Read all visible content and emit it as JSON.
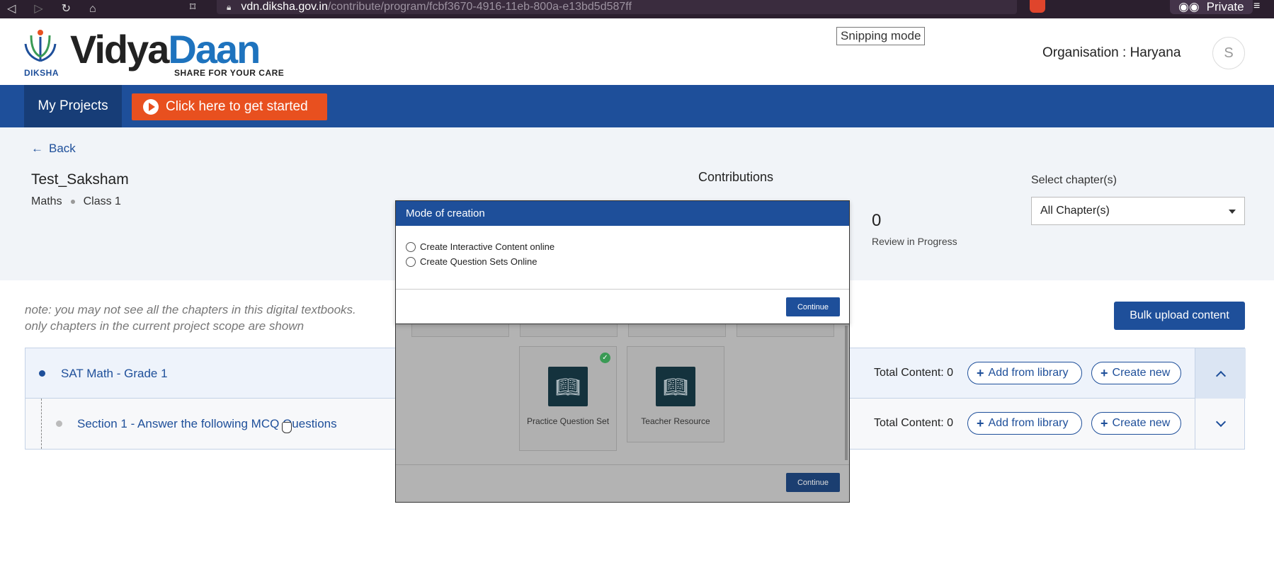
{
  "browser": {
    "url_host": "vdn.diksha.gov.in",
    "url_path": "/contribute/program/fcbf3670-4916-11eb-800a-e13bd5d587ff",
    "private_label": "Private"
  },
  "header": {
    "logo_diksha": "DIKSHA",
    "logo_vidya": "Vidya",
    "logo_daan": "Daan",
    "logo_tagline": "SHARE FOR YOUR CARE",
    "snipping_label": "Snipping mode",
    "organisation": "Organisation : Haryana",
    "avatar_initial": "S"
  },
  "nav": {
    "my_projects": "My Projects",
    "get_started": "Click here to get started"
  },
  "project": {
    "back_label": "Back",
    "title": "Test_Saksham",
    "subject": "Maths",
    "class": "Class 1",
    "contributions_label": "Contributions",
    "review_count": "0",
    "review_label": "Review in Progress",
    "chapter_select_label": "Select chapter(s)",
    "chapter_select_value": "All Chapter(s)"
  },
  "note": {
    "line1": "note: you may not see all the chapters in this digital textbooks.",
    "line2": "only chapters in the current project scope are shown"
  },
  "bulk_upload_label": "Bulk upload content",
  "chapters": [
    {
      "title": "SAT Math - Grade 1",
      "total": "Total Content: 0",
      "add_library": "Add from library",
      "create_new": "Create new"
    },
    {
      "title": "Section 1 - Answer the following MCQ Questions",
      "total": "Total Content: 0",
      "add_library": "Add from library",
      "create_new": "Create new"
    }
  ],
  "background_dialog": {
    "card1_label": "Practice Question Set",
    "card2_label": "Teacher Resource",
    "continue_label": "Continue"
  },
  "modal": {
    "title": "Mode of creation",
    "option1": "Create Interactive Content online",
    "option2": "Create Question Sets Online",
    "continue_label": "Continue"
  },
  "colors": {
    "brand_blue": "#1e4f9a",
    "cta_orange": "#e8501f",
    "check_green": "#3a9a55"
  }
}
